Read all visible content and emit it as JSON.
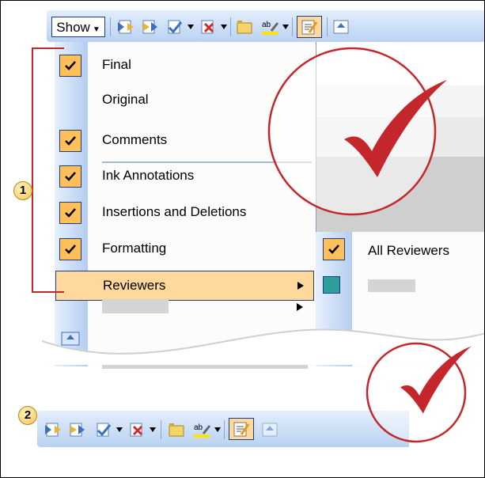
{
  "toolbar": {
    "show_label": "Show",
    "buttons": [
      {
        "icon": "previous-change-icon"
      },
      {
        "icon": "next-change-icon"
      },
      {
        "icon": "accept-change-icon",
        "dropdown": true
      },
      {
        "icon": "reject-change-icon",
        "dropdown": true
      },
      {
        "icon": "new-comment-icon"
      },
      {
        "icon": "highlight-icon",
        "dropdown": true
      },
      {
        "icon": "track-changes-icon",
        "active": true
      },
      {
        "icon": "reviewing-pane-icon"
      }
    ]
  },
  "show_menu": {
    "items": [
      {
        "label": "Final",
        "checked": true
      },
      {
        "label": "Original",
        "checked": false
      },
      {
        "label": "Comments",
        "checked": true
      },
      {
        "label": "Ink Annotations",
        "checked": true
      },
      {
        "label": "Insertions and Deletions",
        "checked": true
      },
      {
        "label": "Formatting",
        "checked": true
      }
    ],
    "reviewers_label": "Reviewers"
  },
  "reviewers_submenu": {
    "items": [
      {
        "label": "All Reviewers",
        "checked": true
      }
    ]
  },
  "callouts": {
    "one": "1",
    "two": "2"
  },
  "colors": {
    "check_bg": "#ffc05c",
    "highlight_bg": "#ffd99c",
    "border_blue": "#1c3d84",
    "callout_red": "#c4262b"
  }
}
